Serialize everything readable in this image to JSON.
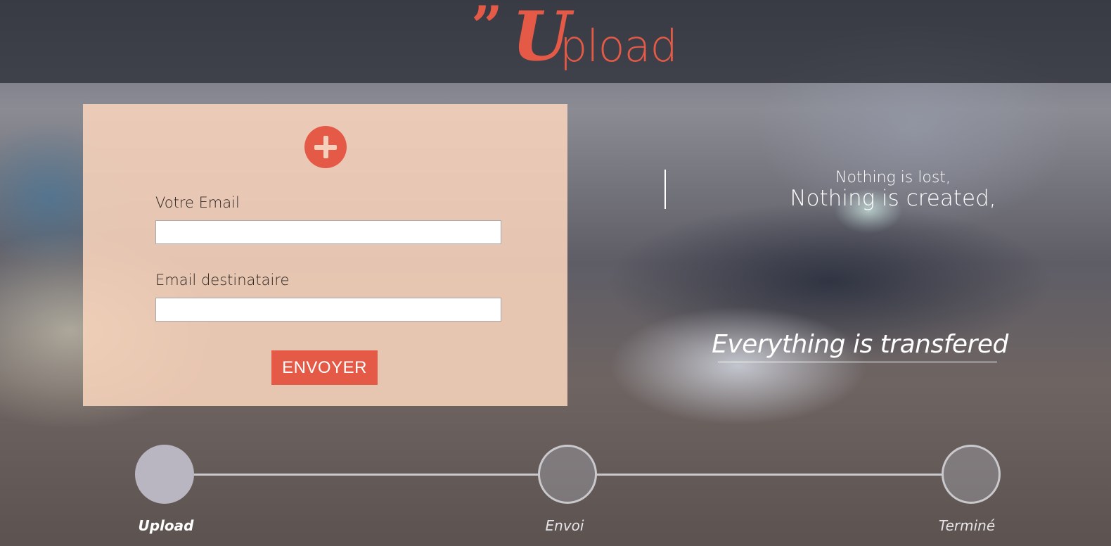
{
  "header": {
    "logo_quote": "”",
    "logo_initial": "U",
    "logo_rest": "pload"
  },
  "form": {
    "add_icon": "plus-icon",
    "email_label": "Votre Email",
    "email_value": "",
    "recipient_label": "Email destinataire",
    "recipient_value": "",
    "submit_label": "ENVOYER"
  },
  "quote": {
    "line1": "Nothing is lost,",
    "line2": "Nothing is created,",
    "line3": "Everything is transfered"
  },
  "steps": [
    {
      "label": "Upload",
      "active": true
    },
    {
      "label": "Envoi",
      "active": false
    },
    {
      "label": "Terminé",
      "active": false
    }
  ],
  "colors": {
    "accent": "#e55a47",
    "panel": "#f8d4bc",
    "step_line": "#c9c8cc"
  }
}
